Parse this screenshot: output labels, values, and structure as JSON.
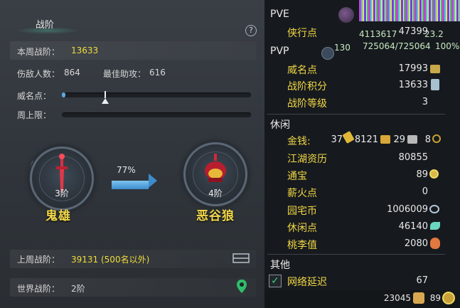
{
  "left": {
    "title": "战阶",
    "help": "?",
    "weekly_label": "本周战阶：",
    "weekly_value": "13633",
    "kills_label": "伤敌人数：",
    "kills_value": "864",
    "assist_label": "最佳助攻：",
    "assist_value": "616",
    "fame_label": "威名点：",
    "fame_fill": 0.02,
    "week_cap_label": "周上限：",
    "week_cap_fill": 0.0,
    "current_rank": {
      "level": "3阶",
      "name": "鬼雄"
    },
    "next_rank": {
      "level": "4阶",
      "name": "恶谷狼"
    },
    "progress_text": "77%",
    "last_week_label": "上周战阶：",
    "last_week_value": "39131 (500名以外)",
    "world_label": "世界战阶：",
    "world_value": "2阶"
  },
  "right": {
    "overlay_a": "4113617",
    "overlay_b": "725064/725064",
    "overlay_c": "130",
    "overlay_d": "23.2",
    "overlay_e": "100%",
    "pve_header": "PVE",
    "pve_items": [
      {
        "label": "侠行点",
        "value": "47399"
      }
    ],
    "pvp_header": "PVP",
    "pvp_items": [
      {
        "label": "威名点",
        "value": "17993"
      },
      {
        "label": "战阶积分",
        "value": "13633"
      },
      {
        "label": "战阶等级",
        "value": "3"
      }
    ],
    "leisure_header": "休闲",
    "money_label": "金钱:",
    "money_gold": "37",
    "money_silver1": "8121",
    "money_silver2": "29",
    "money_copper": "8",
    "leisure_items": [
      {
        "label": "江湖资历",
        "value": "80855"
      },
      {
        "label": "通宝",
        "value": "89"
      },
      {
        "label": "薪火点",
        "value": "0"
      },
      {
        "label": "园宅币",
        "value": "1006009"
      },
      {
        "label": "休闲点",
        "value": "46140"
      },
      {
        "label": "桃李值",
        "value": "2080"
      }
    ],
    "other_header": "其他",
    "latency_label": "网络延迟",
    "latency_value": "67",
    "latency_checked": true,
    "footer_a": "23045",
    "footer_b": "89"
  },
  "colors": {
    "accent_yellow": "#f0dc3c",
    "bar_blue": "#5aa8e0",
    "check_green": "#3ad07a"
  }
}
